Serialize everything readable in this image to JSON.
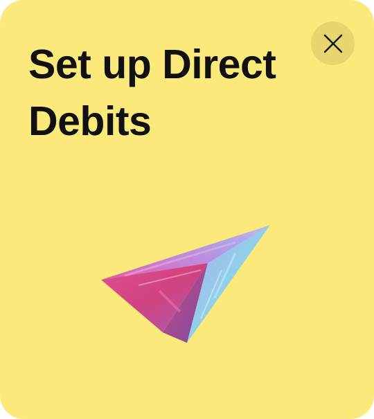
{
  "modal": {
    "title": "Set up Direct Debits",
    "close_icon": "close-icon",
    "illustration_icon": "paper-plane-icon",
    "colors": {
      "background": "#fbe97b",
      "close_button_bg": "#e6d670",
      "text": "#111111"
    }
  }
}
